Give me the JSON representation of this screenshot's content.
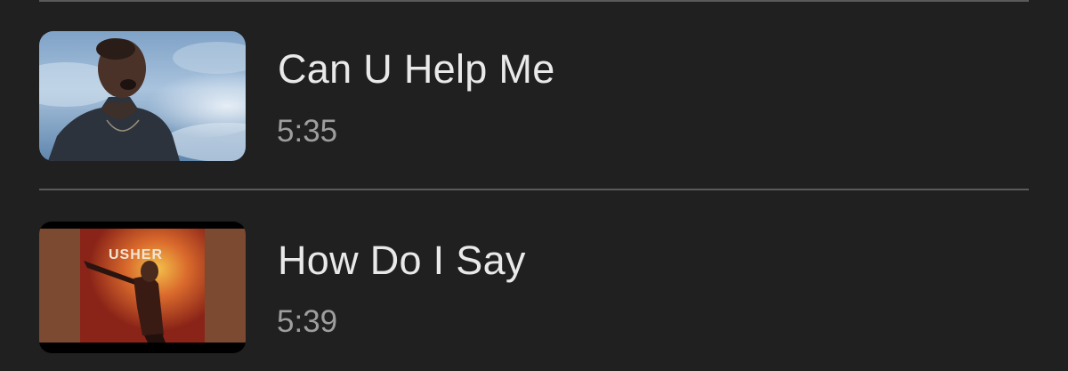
{
  "tracks": [
    {
      "title": "Can U Help Me",
      "duration": "5:35",
      "thumbnail": "singer-in-clouds-thumbnail"
    },
    {
      "title": "How Do I Say",
      "duration": "5:39",
      "thumbnail": "album-cover-thumbnail",
      "thumbnail_text": "USHER"
    }
  ],
  "colors": {
    "background": "#202020",
    "divider": "#5a5a5a",
    "title": "#e9e9e9",
    "duration": "#9e9e9e"
  }
}
